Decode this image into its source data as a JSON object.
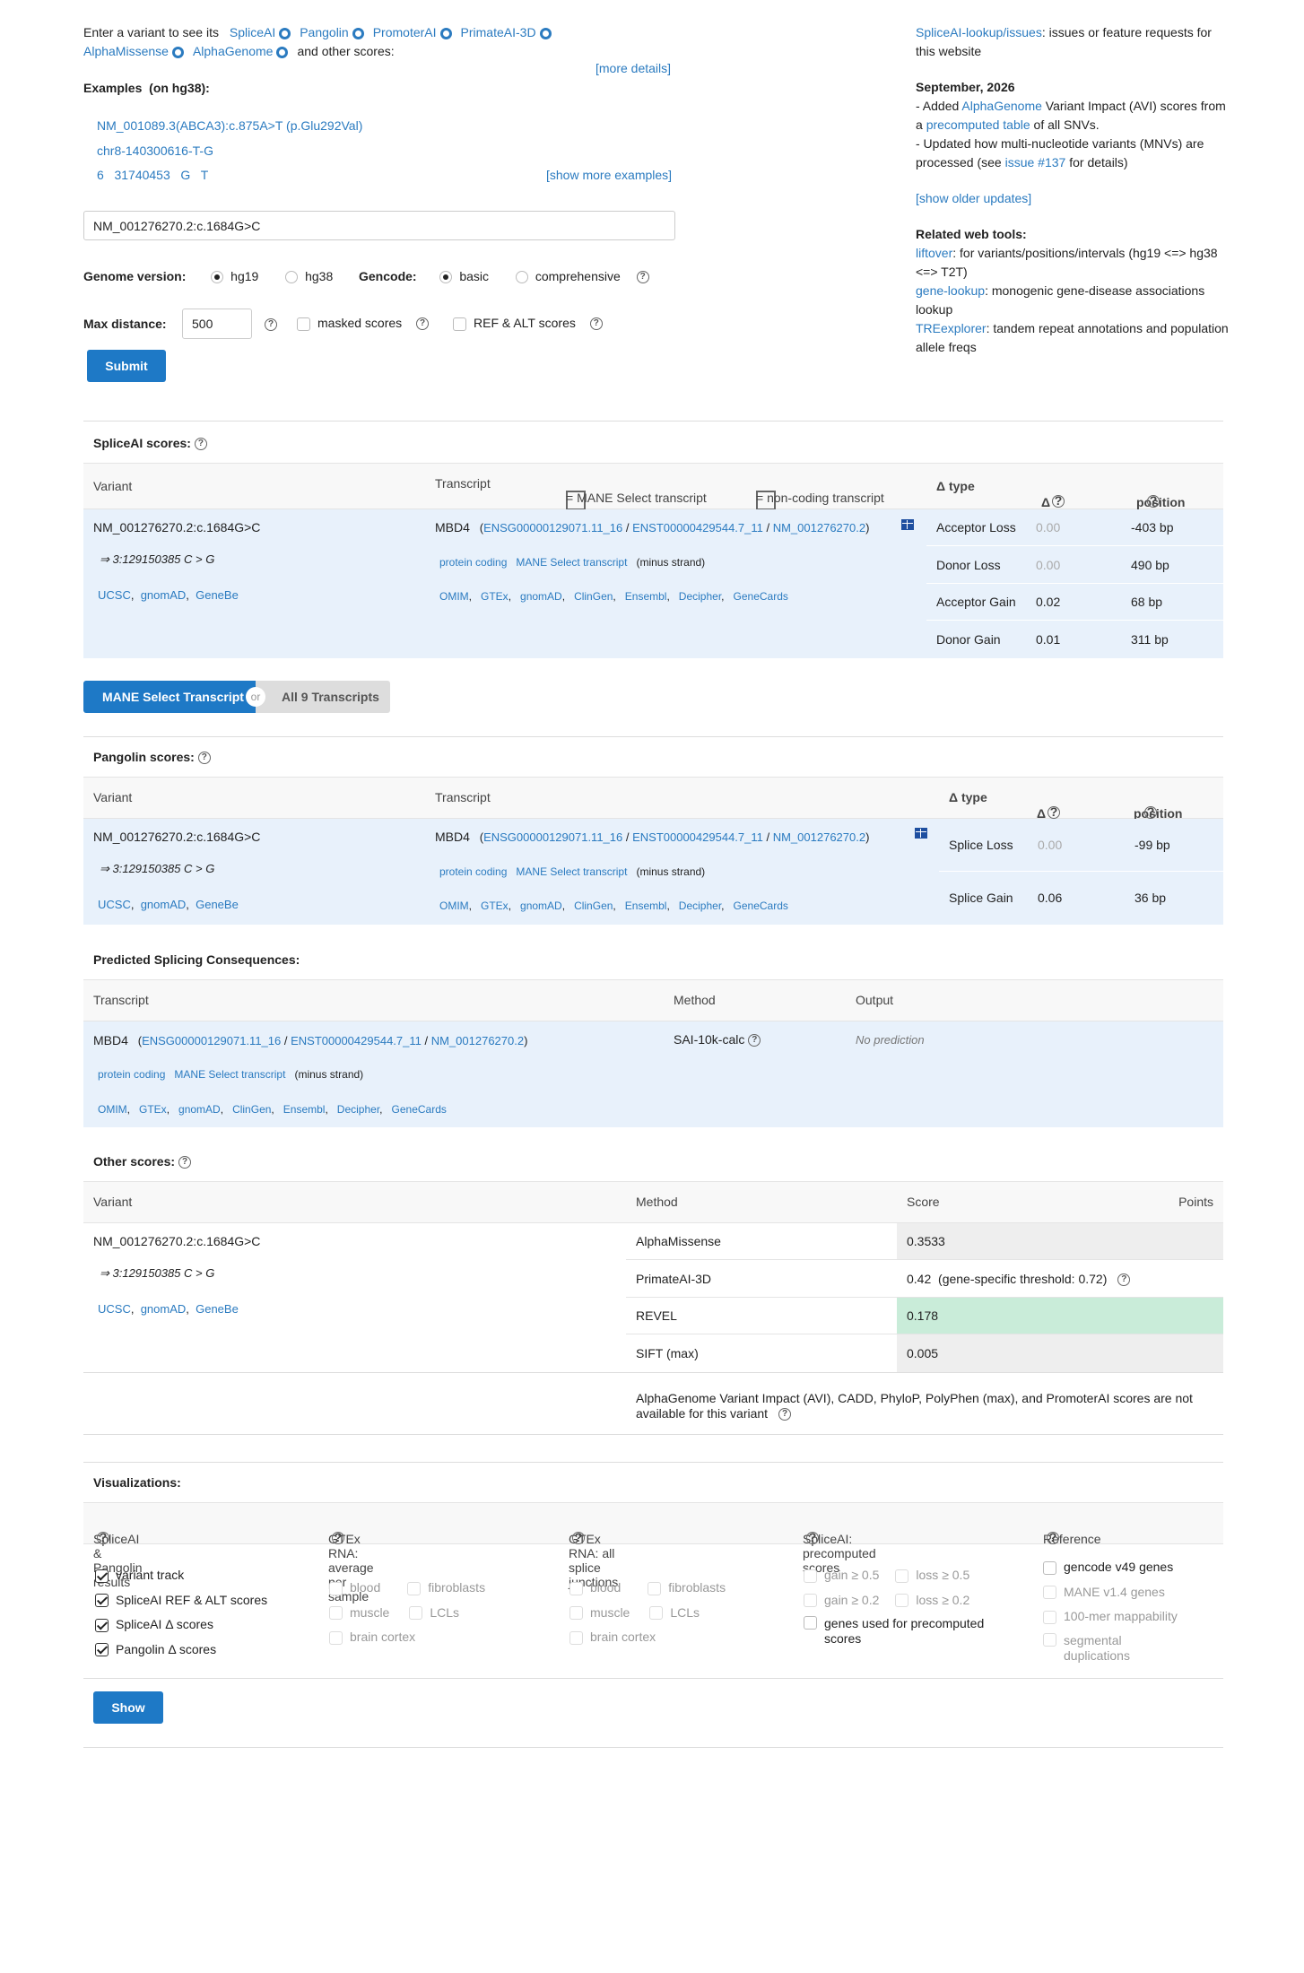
{
  "intro": {
    "prefix": "Enter a variant to see its",
    "tools": [
      "SpliceAI",
      "Pangolin",
      "PromoterAI",
      "PrimateAI-3D",
      "AlphaMissense",
      "AlphaGenome"
    ],
    "suffix": "and other scores:",
    "more_details": "[more details]"
  },
  "examples": {
    "title": "Examples",
    "build": "(on hg38):",
    "items": [
      "NM_001089.3(ABCA3):c.875A>T (p.Glu292Val)",
      "chr8-140300616-T-G",
      "6   31740453   G   T"
    ],
    "show_more": "[show more examples]"
  },
  "search": {
    "value": "NM_001276270.2:c.1684G>C"
  },
  "options": {
    "genome_label": "Genome version:",
    "genome_opts": [
      "hg19",
      "hg38"
    ],
    "gencode_label": "Gencode:",
    "gencode_opts": [
      "basic",
      "comprehensive"
    ],
    "maxdist_label": "Max distance:",
    "maxdist_value": "500",
    "masked": "masked scores",
    "refalt": "REF & ALT scores",
    "submit": "Submit"
  },
  "news": {
    "issues_link": "SpliceAI-lookup/issues",
    "issues_text": ": issues or feature requests for this website",
    "date": "September, 2026",
    "line1a": "- Added ",
    "line1b": "AlphaGenome",
    "line1c": " Variant Impact (AVI) scores from a ",
    "line1d": "precomputed table",
    "line1e": " of all SNVs.",
    "line2a": "- Updated how multi-nucleotide variants (MNVs) are processed (see ",
    "line2b": "issue #137",
    "line2c": " for details)",
    "older": "[show older updates]",
    "related_title": "Related web tools:",
    "tools": [
      {
        "name": "liftover",
        "desc": ": for variants/positions/intervals (hg19 <=> hg38 <=> T2T)"
      },
      {
        "name": "gene-lookup",
        "desc": ": monogenic gene-disease associations lookup"
      },
      {
        "name": "TREexplorer",
        "desc": ": tandem repeat annotations and population allele freqs"
      }
    ]
  },
  "variant": {
    "name": "NM_001276270.2:c.1684G>C",
    "coords": "⇒ 3:129150385 C > G",
    "links": [
      "UCSC",
      "gnomAD",
      "GeneBe"
    ]
  },
  "transcript": {
    "gene": "MBD4",
    "ids": [
      "ENSG00000129071.11_16",
      "ENST00000429544.7_11",
      "NM_001276270.2"
    ],
    "biotype": "protein coding",
    "mane": "MANE Select transcript",
    "strand": "(minus strand)",
    "links": [
      "OMIM",
      "GTEx",
      "gnomAD",
      "ClinGen",
      "Ensembl",
      "Decipher",
      "GeneCards"
    ]
  },
  "spliceai": {
    "title": "SpliceAI scores:",
    "col_variant": "Variant",
    "col_transcript": "Transcript",
    "legend_mane": "= MANE Select transcript",
    "legend_noncoding": "= non-coding transcript",
    "col_type": "Δ type",
    "col_score": "Δ score",
    "col_pos": "position",
    "rows": [
      {
        "type": "Acceptor Loss",
        "score": "0.00",
        "pos": "-403 bp"
      },
      {
        "type": "Donor Loss",
        "score": "0.00",
        "pos": "490 bp"
      },
      {
        "type": "Acceptor Gain",
        "score": "0.02",
        "pos": "68 bp"
      },
      {
        "type": "Donor Gain",
        "score": "0.01",
        "pos": "311 bp"
      }
    ]
  },
  "toggle": {
    "mane": "MANE Select Transcript",
    "or": "or",
    "all": "All 9 Transcripts"
  },
  "pangolin": {
    "title": "Pangolin scores:",
    "rows": [
      {
        "type": "Splice Loss",
        "score": "0.00",
        "pos": "-99 bp"
      },
      {
        "type": "Splice Gain",
        "score": "0.06",
        "pos": "36 bp"
      }
    ]
  },
  "consequences": {
    "title": "Predicted Splicing Consequences:",
    "col_transcript": "Transcript",
    "col_method": "Method",
    "col_output": "Output",
    "method": "SAI-10k-calc",
    "output": "No prediction"
  },
  "other": {
    "title": "Other scores:",
    "col_variant": "Variant",
    "col_method": "Method",
    "col_score": "Score",
    "col_points": "Points",
    "rows": [
      {
        "method": "AlphaMissense",
        "score": "0.3533",
        "color": "#eeeeee"
      },
      {
        "method": "PrimateAI-3D",
        "score": "0.42  (gene-specific threshold: 0.72)",
        "color": "#ffffff"
      },
      {
        "method": "REVEL",
        "score": "0.178",
        "color": "#c9ecd9"
      },
      {
        "method": "SIFT (max)",
        "score": "0.005",
        "color": "#eeeeee"
      }
    ],
    "note": "AlphaGenome Variant Impact (AVI),  CADD,  PhyloP,  PolyPhen (max),  and PromoterAI scores are not available for this variant"
  },
  "viz": {
    "title": "Visualizations:",
    "groups": [
      {
        "title": "SpliceAI & Pangolin results"
      },
      {
        "title": "GTEx RNA: average per sample"
      },
      {
        "title": "GTEx RNA: all splice junctions"
      },
      {
        "title": "SpliceAI: precomputed scores"
      },
      {
        "title": "Reference"
      }
    ],
    "results": [
      "variant track",
      "SpliceAI REF & ALT scores",
      "SpliceAI Δ  scores",
      "Pangolin Δ  scores"
    ],
    "tissues": [
      "blood",
      "fibroblasts",
      "muscle",
      "LCLs",
      "brain cortex"
    ],
    "precomp": [
      "gain ≥ 0.5",
      "loss ≥ 0.5",
      "gain ≥ 0.2",
      "loss ≥ 0.2",
      "genes used for precomputed scores"
    ],
    "reference": [
      "gencode v49 genes",
      "MANE v1.4 genes",
      "100-mer mappability",
      "segmental duplications"
    ],
    "show": "Show"
  }
}
